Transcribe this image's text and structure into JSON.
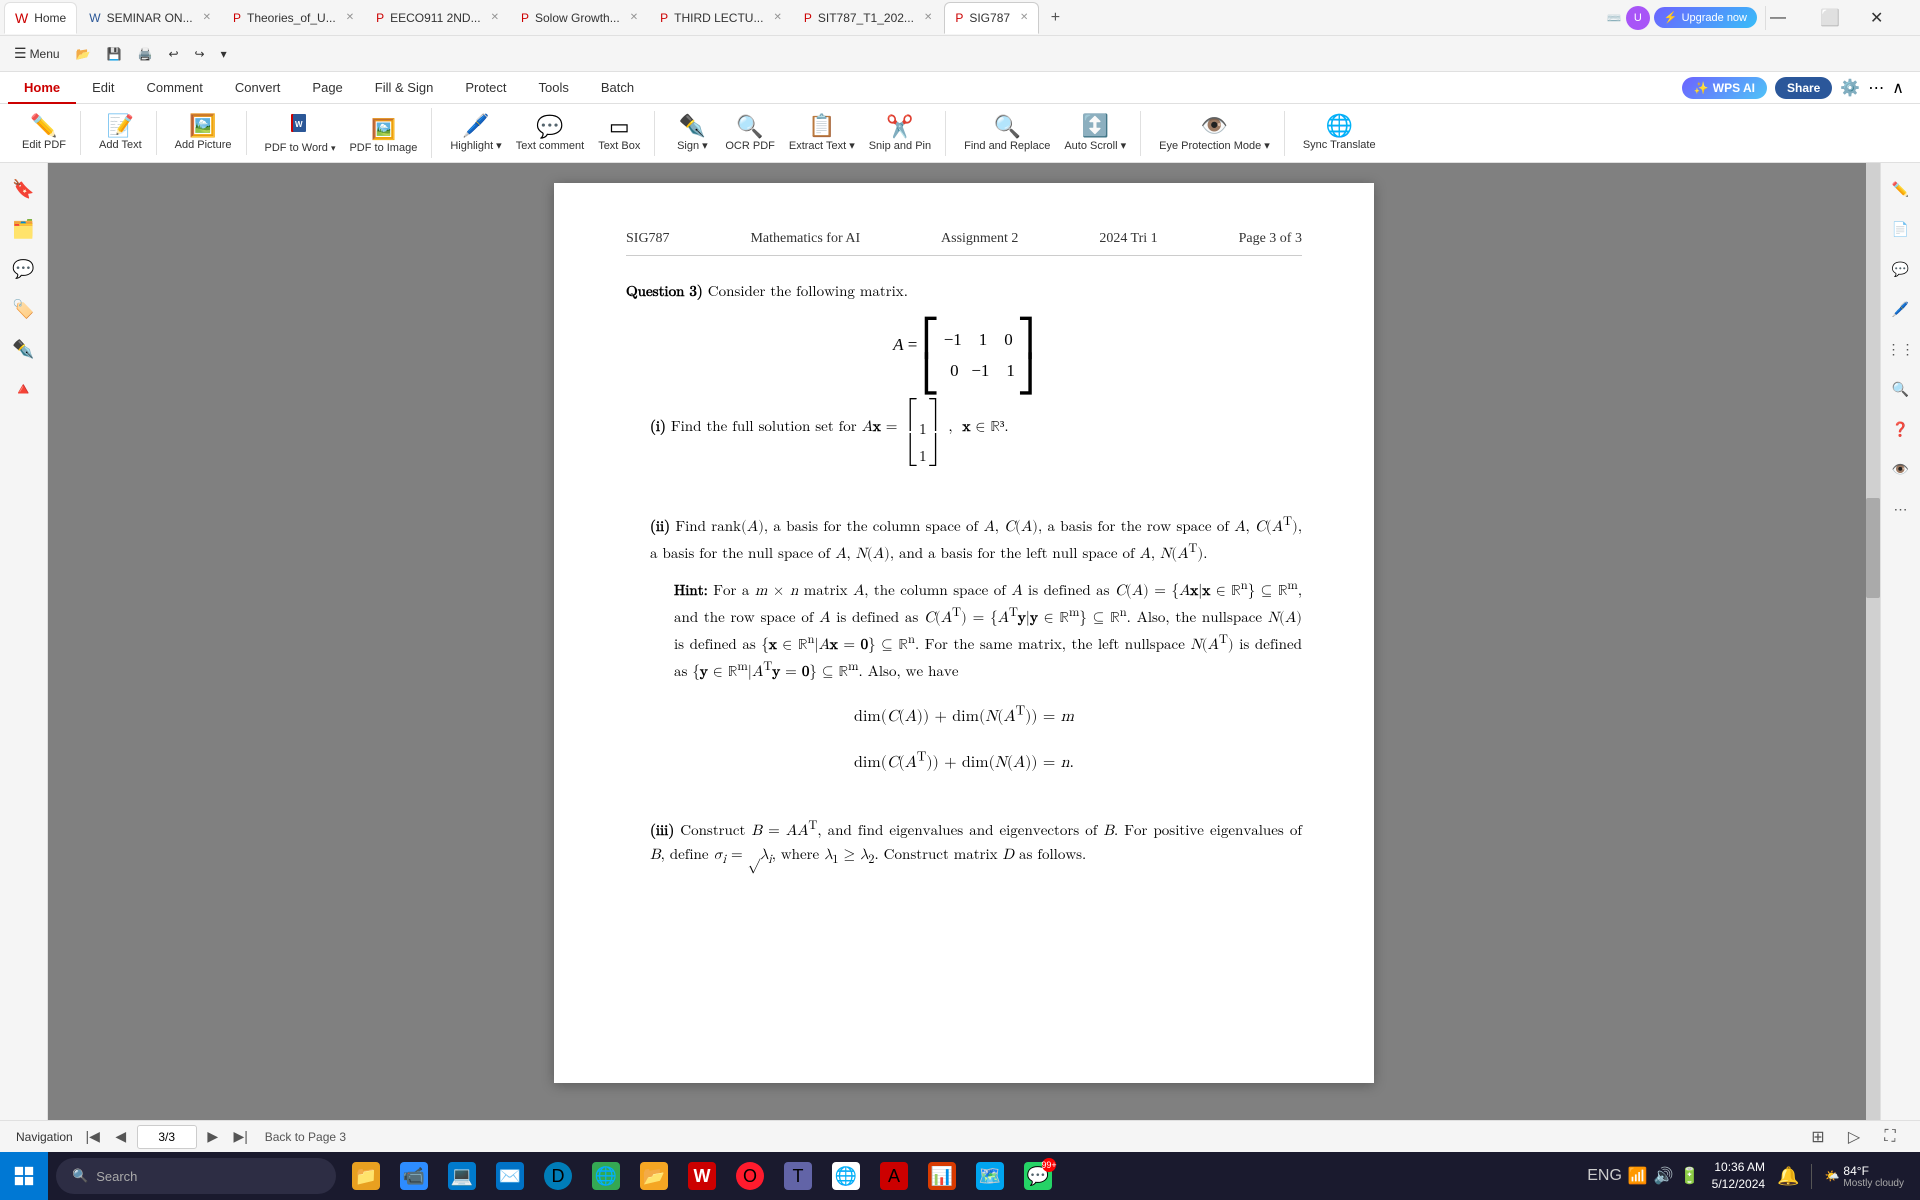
{
  "window": {
    "title": "SIG787"
  },
  "tabs": [
    {
      "id": "home",
      "label": "Home",
      "icon": "🔴",
      "active": true
    },
    {
      "id": "seminar",
      "label": "SEMINAR ON...",
      "icon": "📄",
      "active": false
    },
    {
      "id": "theories",
      "label": "Theories_of_U...",
      "icon": "📄",
      "active": false
    },
    {
      "id": "eeco911",
      "label": "EECO911 2ND...",
      "icon": "📄",
      "active": false
    },
    {
      "id": "solow",
      "label": "Solow Growth...",
      "icon": "📄",
      "active": false
    },
    {
      "id": "third",
      "label": "THIRD LECTU...",
      "icon": "📄",
      "active": false
    },
    {
      "id": "sit787",
      "label": "SIT787_T1_202...",
      "icon": "📄",
      "active": false
    },
    {
      "id": "sig787",
      "label": "SIG787",
      "icon": "📄",
      "active": true
    }
  ],
  "ribbon": {
    "tabs": [
      "Home",
      "Edit",
      "Comment",
      "Convert",
      "Page",
      "Fill & Sign",
      "Protect",
      "Tools",
      "Batch"
    ],
    "active_tab": "Home",
    "buttons": [
      {
        "id": "edit-pdf",
        "label": "Edit PDF",
        "icon": "✏️"
      },
      {
        "id": "add-text",
        "label": "Add Text",
        "icon": "📝"
      },
      {
        "id": "add-picture",
        "label": "Add Picture",
        "icon": "🖼️"
      },
      {
        "id": "pdf-to-word",
        "label": "PDF to Word",
        "icon": "📄"
      },
      {
        "id": "pdf-to-image",
        "label": "PDF to Image",
        "icon": "🖼️"
      },
      {
        "id": "highlight",
        "label": "Highlight",
        "icon": "🖊️"
      },
      {
        "id": "text-comment",
        "label": "Text comment",
        "icon": "💬"
      },
      {
        "id": "text-box",
        "label": "Text Box",
        "icon": "▭"
      },
      {
        "id": "sign",
        "label": "Sign",
        "icon": "✒️"
      },
      {
        "id": "ocr-pdf",
        "label": "OCR PDF",
        "icon": "🔍"
      },
      {
        "id": "extract-text",
        "label": "Extract Text",
        "icon": "📋"
      },
      {
        "id": "snip-pin",
        "label": "Snip and Pin",
        "icon": "✂️"
      },
      {
        "id": "find-replace",
        "label": "Find and Replace",
        "icon": "🔍"
      },
      {
        "id": "auto-scroll",
        "label": "Auto Scroll",
        "icon": "↕️"
      },
      {
        "id": "eye-protection",
        "label": "Eye Protection Mode",
        "icon": "👁️"
      },
      {
        "id": "sync-translate",
        "label": "Sync Translate",
        "icon": "🌐"
      }
    ],
    "ai_button": "WPS AI",
    "share_button": "Share"
  },
  "pdf": {
    "header": {
      "course": "SIG787",
      "title": "Mathematics for AI",
      "assignment": "Assignment 2",
      "tri": "2024 Tri 1",
      "page": "Page 3 of 3"
    },
    "content": {
      "question3_label": "Question 3)",
      "question3_intro": "Consider the following matrix.",
      "matrix_A": "A = [[-1, 1, 0], [0, -1, 1]]",
      "part_i_label": "(i)",
      "part_i_text": "Find the full solution set for",
      "part_i_eq": "Ax = [1, 1]ᵀ",
      "part_i_domain": "x ∈ ℝ³",
      "part_ii_label": "(ii)",
      "part_ii_text": "Find rank(A), a basis for the column space of A, C(A), a basis for the row space of A, C(Aᵀ), a basis for the null space of A, N(A), and a basis for the left null space of A, N(Aᵀ).",
      "hint_label": "Hint:",
      "hint_text": "For a m × n matrix A, the column space of A is defined as C(A) = {Ax|x ∈ ℝⁿ} ⊆ ℝᵐ, and the row space of A is defined as C(Aᵀ) = {Aᵀy|y ∈ ℝᵐ} ⊆ ℝⁿ. Also, the nullspace N(A) is defined as {x ∈ ℝⁿ|Ax = 0} ⊆ ℝⁿ. For the same matrix, the left nullspace N(Aᵀ) is defined as {y ∈ ℝᵐ|Aᵀy = 0} ⊆ ℝᵐ. Also, we have",
      "eq1": "dim(C(A)) + dim(N(Aᵀ)) = m",
      "eq2": "dim(C(Aᵀ)) + dim(N(A)) = n.",
      "part_iii_label": "(iii)",
      "part_iii_text": "Construct B = AAᵀ, and find eigenvalues and eigenvectors of B. For positive eigenvalues of B, define σᵢ = √λᵢ, where λ₁ ≥ λ₂. Construct matrix D as follows."
    }
  },
  "statusbar": {
    "navigation_label": "Navigation",
    "page_current": "3/3",
    "back_label": "Back to Page 3",
    "search_placeholder": "Search"
  },
  "sidebar_left": {
    "icons": [
      "bookmark",
      "thumbnail",
      "comment",
      "tag",
      "signature",
      "layers"
    ]
  },
  "sidebar_right": {
    "icons": [
      "edit",
      "page",
      "comment",
      "pen",
      "columns",
      "zoom",
      "help",
      "user",
      "more"
    ]
  },
  "taskbar": {
    "weather": "84°F",
    "weather_desc": "Mostly cloudy",
    "time": "10:36 AM",
    "date": "5/12/2024",
    "search_placeholder": "Search"
  }
}
